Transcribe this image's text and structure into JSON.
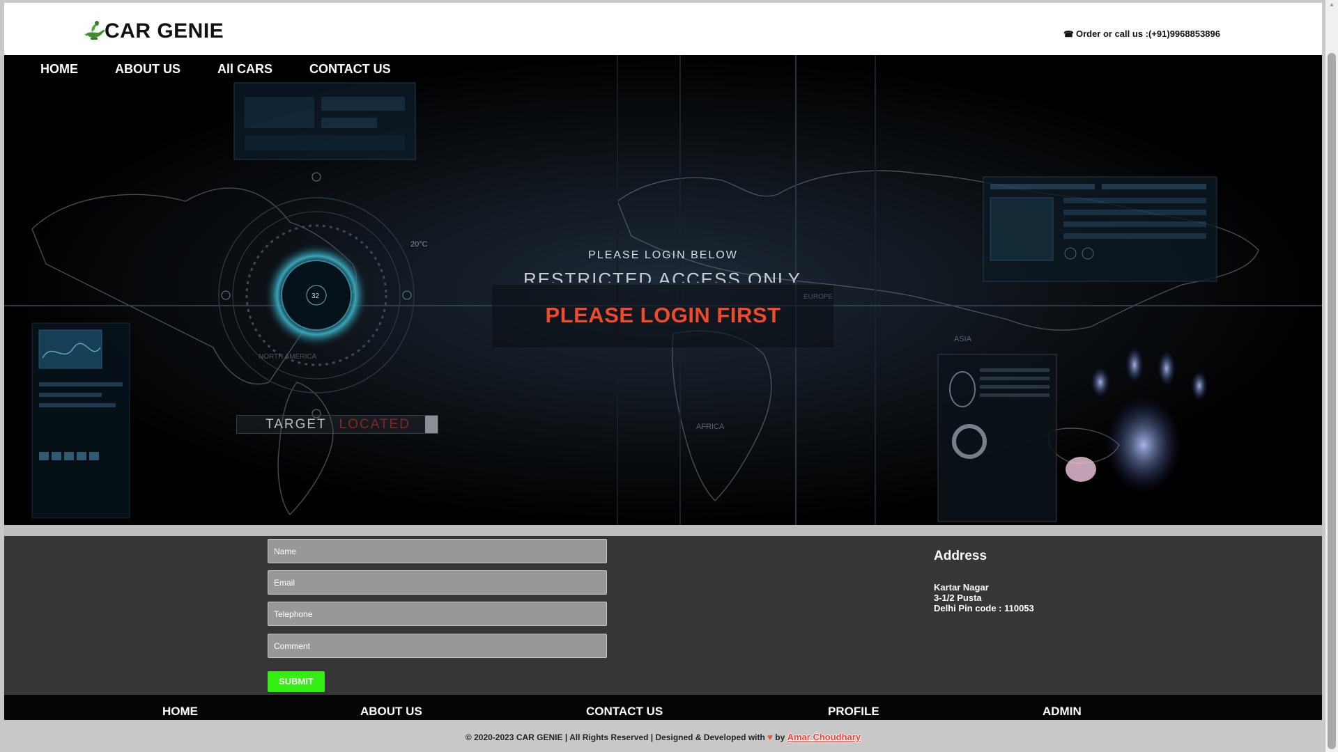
{
  "header": {
    "brand": "CAR GENIE",
    "callout": "Order or call us :(+91)9968853896",
    "logo_icon": "genie-lamp-icon",
    "phone_icon": "telephone-icon"
  },
  "nav": {
    "items": [
      "HOME",
      "ABOUT US",
      "All CARS",
      "CONTACT US"
    ]
  },
  "hero": {
    "line1": "PLEASE LOGIN BELOW",
    "line2": "RESTRICTED ACCESS ONLY",
    "message": "PLEASE LOGIN FIRST",
    "temp_label": "20°C",
    "dial_value": "32",
    "region_asia": "ASIA",
    "region_africa": "AFRICA",
    "region_america": "NORTH AMERICA",
    "region_europe": "EUROPE",
    "target_word1": "TARGET",
    "target_word2": "LOCATED",
    "message_color": "#f04a2c"
  },
  "form": {
    "name_placeholder": "Name",
    "email_placeholder": "Email",
    "telephone_placeholder": "Telephone",
    "comment_placeholder": "Comment",
    "submit_label": "SUBMIT",
    "submit_color": "#33ee11"
  },
  "address": {
    "title": "Address",
    "line1": "Kartar Nagar",
    "line2": "3-1/2 Pusta",
    "line3": "Delhi Pin code : 110053"
  },
  "footer_nav": {
    "items": [
      "HOME",
      "ABOUT US",
      "CONTACT US",
      "PROFILE",
      "ADMIN"
    ]
  },
  "copyright": {
    "text": "© 2020-2023 CAR GENIE | All Rights Reserved | Designed & Developed with",
    "by": "by",
    "author": "Amar Choudhary",
    "heart_icon": "heart-icon"
  }
}
